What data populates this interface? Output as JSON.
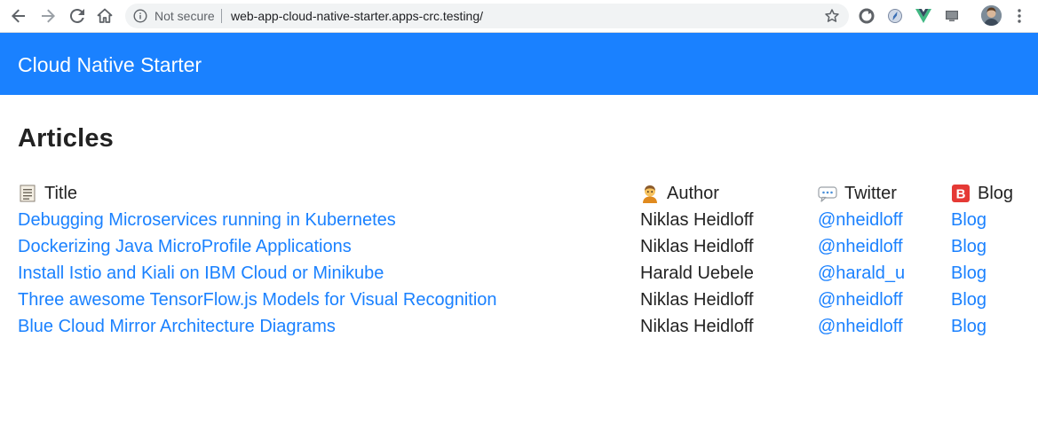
{
  "browser": {
    "security_label": "Not secure",
    "url": "web-app-cloud-native-starter.apps-crc.testing/"
  },
  "app": {
    "title": "Cloud Native Starter"
  },
  "page": {
    "heading": "Articles"
  },
  "table": {
    "headers": {
      "title": "Title",
      "author": "Author",
      "twitter": "Twitter",
      "blog": "Blog"
    },
    "rows": [
      {
        "title": "Debugging Microservices running in Kubernetes",
        "author": "Niklas Heidloff",
        "twitter": "@nheidloff",
        "blog": "Blog"
      },
      {
        "title": "Dockerizing Java MicroProfile Applications",
        "author": "Niklas Heidloff",
        "twitter": "@nheidloff",
        "blog": "Blog"
      },
      {
        "title": "Install Istio and Kiali on IBM Cloud or Minikube",
        "author": "Harald Uebele",
        "twitter": "@harald_u",
        "blog": "Blog"
      },
      {
        "title": "Three awesome TensorFlow.js Models for Visual Recognition",
        "author": "Niklas Heidloff",
        "twitter": "@nheidloff",
        "blog": "Blog"
      },
      {
        "title": "Blue Cloud Mirror Architecture Diagrams",
        "author": "Niklas Heidloff",
        "twitter": "@nheidloff",
        "blog": "Blog"
      }
    ]
  },
  "colors": {
    "header_bg": "#1a81ff",
    "link": "#1a81ff",
    "text": "#222222"
  }
}
